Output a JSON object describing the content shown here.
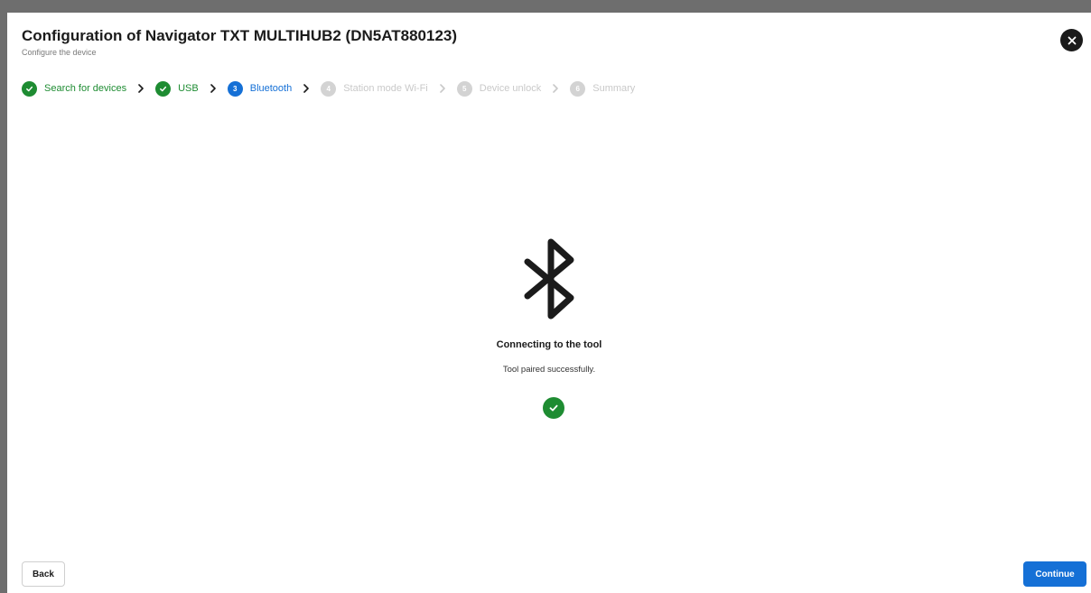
{
  "dialog": {
    "title": "Configuration of Navigator TXT MULTIHUB2 (DN5AT880123)",
    "subtitle": "Configure the device",
    "close_icon": "close-icon"
  },
  "stepper": {
    "steps": [
      {
        "number": "1",
        "label": "Search for devices",
        "state": "done"
      },
      {
        "number": "2",
        "label": "USB",
        "state": "done"
      },
      {
        "number": "3",
        "label": "Bluetooth",
        "state": "current"
      },
      {
        "number": "4",
        "label": "Station mode Wi-Fi",
        "state": "todo"
      },
      {
        "number": "5",
        "label": "Device unlock",
        "state": "todo"
      },
      {
        "number": "6",
        "label": "Summary",
        "state": "todo"
      }
    ],
    "separator_icon": "chevron-right-icon"
  },
  "main": {
    "icon": "bluetooth-icon",
    "status_title": "Connecting to the tool",
    "status_message": "Tool paired successfully.",
    "status_icon": "check-circle-icon"
  },
  "footer": {
    "back_label": "Back",
    "continue_label": "Continue"
  },
  "colors": {
    "done": "#1e8c32",
    "current": "#1570d6",
    "todo": "#d3d3d3",
    "primary_button": "#1570d6"
  }
}
